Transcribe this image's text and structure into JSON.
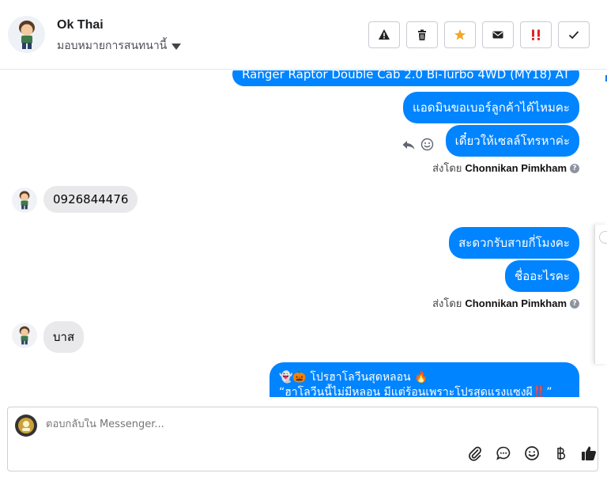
{
  "header": {
    "contact_name": "Ok Thai",
    "assign_label": "มอบหมายการสนทนานี้",
    "actions": [
      {
        "name": "spam-button",
        "icon": "warning-icon"
      },
      {
        "name": "delete-button",
        "icon": "trash-icon"
      },
      {
        "name": "star-button",
        "icon": "star-icon",
        "color": "#f5a623"
      },
      {
        "name": "mark-unread-button",
        "icon": "envelope-icon"
      },
      {
        "name": "follow-up-button",
        "icon": "exclamation-icon",
        "color": "#e02424"
      },
      {
        "name": "done-button",
        "icon": "check-icon"
      }
    ]
  },
  "messages": {
    "out1": "Ranger Raptor Double Cab 2.0 Bi-Turbo 4WD (MY18) AT",
    "out2": "แอดมินขอเบอร์ลูกค้าได้ไหมคะ",
    "out3": "เดี๋ยวให้เซลล์โทรหาค่ะ",
    "sent_by_prefix": "ส่งโดย",
    "sent_by_name": "Chonnikan Pimkham",
    "in1": "0926844476",
    "out4": "สะดวกรับสายกี่โมงคะ",
    "out5": "ชื่ออะไรคะ",
    "in2": "บาส",
    "promo_line1": "👻🎃 โปรฮาโลวีนสุดหลอน 🔥",
    "promo_line2": "“ฮาโลวีนนี้ไม่มีหลอน มีแต่ร้อนเพราะโปรสุดแรงแซงผี‼️”"
  },
  "composer": {
    "placeholder": "ตอบกลับใน Messenger..."
  },
  "colors": {
    "outgoing_bubble": "#0084ff",
    "incoming_bubble": "#e9e9eb"
  }
}
